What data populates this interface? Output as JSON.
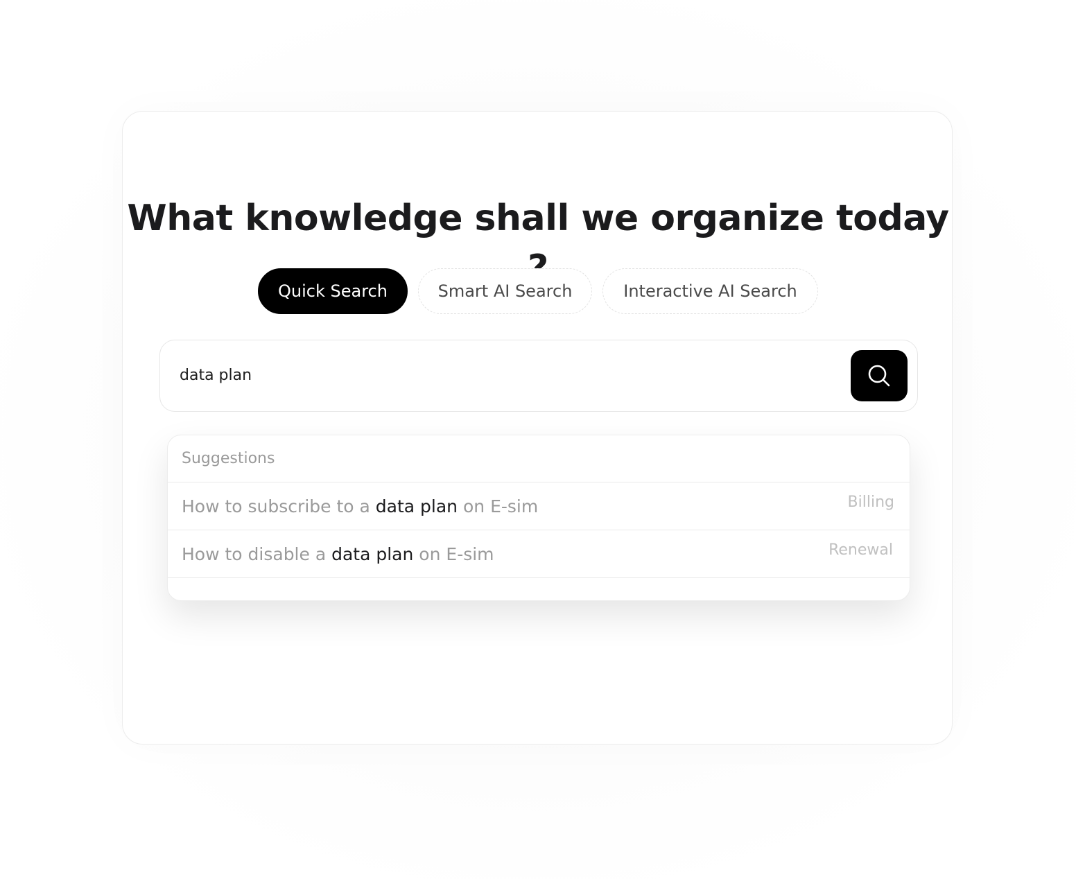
{
  "heading": "What knowledge shall we organize today ?",
  "tabs": [
    {
      "label": "Quick Search",
      "active": true
    },
    {
      "label": "Smart AI Search",
      "active": false
    },
    {
      "label": "Interactive AI Search",
      "active": false
    }
  ],
  "search": {
    "value": "data plan",
    "button_icon": "search-icon"
  },
  "suggestions": {
    "header": "Suggestions",
    "items": [
      {
        "before": "How to subscribe to a ",
        "match": "data plan",
        "after": " on E-sim",
        "tag": "Billing"
      },
      {
        "before": "How to disable a ",
        "match": "data plan",
        "after": " on E-sim",
        "tag": "Renewal"
      }
    ]
  },
  "colors": {
    "accent": "#000000",
    "heading": "#1b1b1d",
    "muted": "#9a9a9a",
    "tag": "#c0c0c0"
  }
}
